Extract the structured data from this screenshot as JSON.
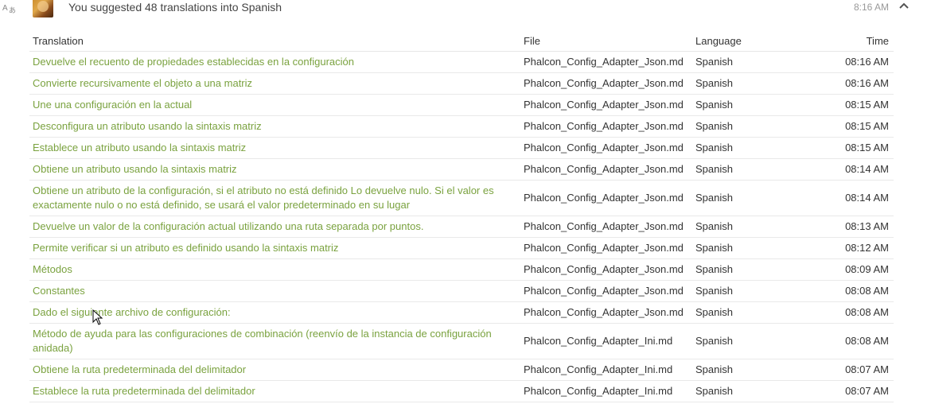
{
  "header": {
    "summary": "You suggested 48 translations into Spanish",
    "time": "8:16 AM",
    "icons": {
      "activity": "translate-icon",
      "collapse": "chevron-up-icon",
      "avatar": "user-avatar"
    }
  },
  "table": {
    "columns": {
      "translation": "Translation",
      "file": "File",
      "language": "Language",
      "time": "Time"
    },
    "rows": [
      {
        "translation": "Devuelve el recuento de propiedades establecidas en la configuración",
        "file": "Phalcon_Config_Adapter_Json.md",
        "language": "Spanish",
        "time": "08:16 AM"
      },
      {
        "translation": "Convierte recursivamente el objeto a una matriz",
        "file": "Phalcon_Config_Adapter_Json.md",
        "language": "Spanish",
        "time": "08:16 AM"
      },
      {
        "translation": "Une una configuración en la actual",
        "file": "Phalcon_Config_Adapter_Json.md",
        "language": "Spanish",
        "time": "08:15 AM"
      },
      {
        "translation": "Desconfigura un atributo usando la sintaxis matriz",
        "file": "Phalcon_Config_Adapter_Json.md",
        "language": "Spanish",
        "time": "08:15 AM"
      },
      {
        "translation": "Establece un atributo usando la sintaxis matriz",
        "file": "Phalcon_Config_Adapter_Json.md",
        "language": "Spanish",
        "time": "08:15 AM"
      },
      {
        "translation": "Obtiene un atributo usando la sintaxis matriz",
        "file": "Phalcon_Config_Adapter_Json.md",
        "language": "Spanish",
        "time": "08:14 AM"
      },
      {
        "translation": "Obtiene un atributo de la configuración, si el atributo no está definido Lo devuelve nulo. Si el valor es exactamente nulo o no está definido, se usará el valor predeterminado en su lugar",
        "file": "Phalcon_Config_Adapter_Json.md",
        "language": "Spanish",
        "time": "08:14 AM"
      },
      {
        "translation": "Devuelve un valor de la configuración actual utilizando una ruta separada por puntos.",
        "file": "Phalcon_Config_Adapter_Json.md",
        "language": "Spanish",
        "time": "08:13 AM"
      },
      {
        "translation": "Permite verificar si un atributo es definido usando la sintaxis matriz",
        "file": "Phalcon_Config_Adapter_Json.md",
        "language": "Spanish",
        "time": "08:12 AM"
      },
      {
        "translation": "Métodos",
        "file": "Phalcon_Config_Adapter_Json.md",
        "language": "Spanish",
        "time": "08:09 AM"
      },
      {
        "translation": "Constantes",
        "file": "Phalcon_Config_Adapter_Json.md",
        "language": "Spanish",
        "time": "08:08 AM"
      },
      {
        "translation": "Dado el siguiente archivo de configuración:",
        "file": "Phalcon_Config_Adapter_Json.md",
        "language": "Spanish",
        "time": "08:08 AM"
      },
      {
        "translation": "Método de ayuda para las configuraciones de combinación (reenvío de la instancia de configuración anidada)",
        "file": "Phalcon_Config_Adapter_Ini.md",
        "language": "Spanish",
        "time": "08:08 AM"
      },
      {
        "translation": "Obtiene la ruta predeterminada del delimitador",
        "file": "Phalcon_Config_Adapter_Ini.md",
        "language": "Spanish",
        "time": "08:07 AM"
      },
      {
        "translation": "Establece la ruta predeterminada del delimitador",
        "file": "Phalcon_Config_Adapter_Ini.md",
        "language": "Spanish",
        "time": "08:07 AM"
      }
    ]
  },
  "colors": {
    "link": "#7aa23f",
    "text": "#333333",
    "muted": "#999999",
    "border": "#e9e9e9"
  }
}
